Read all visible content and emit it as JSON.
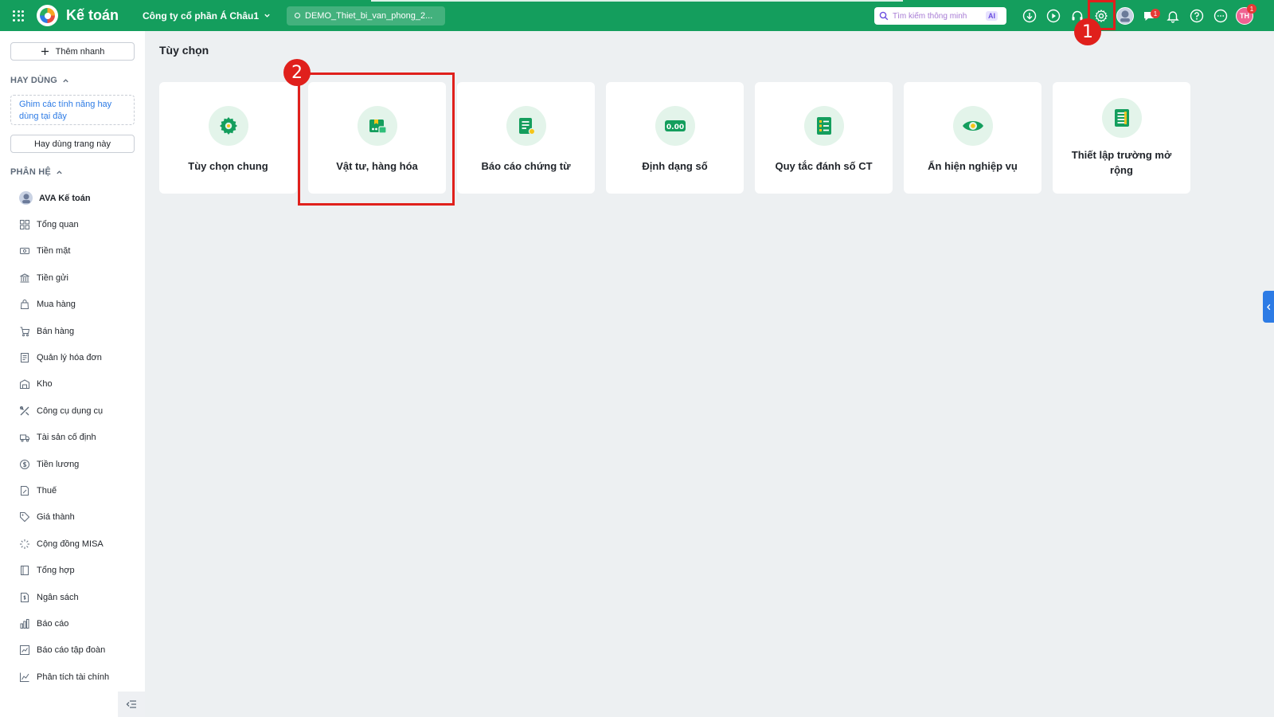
{
  "header": {
    "app_title": "Kế toán",
    "company": "Công ty cổ phần Á Châu1",
    "database": "DEMO_Thiet_bi_van_phong_2...",
    "search_placeholder": "Tìm kiếm thông minh",
    "ai_label": "AI",
    "chat_badge": "1",
    "user_initials": "TH",
    "user_badge": "1"
  },
  "sidebar": {
    "quick_add": "Thêm nhanh",
    "frequent_heading": "HAY DÙNG",
    "pin_hint": "Ghim các tính năng hay dùng tại đây",
    "use_page": "Hay dùng trang này",
    "modules_heading": "PHÂN HỆ",
    "items": [
      {
        "label": "AVA Kế toán",
        "icon": "ava-icon"
      },
      {
        "label": "Tổng quan",
        "icon": "dashboard-icon"
      },
      {
        "label": "Tiền mặt",
        "icon": "cash-icon"
      },
      {
        "label": "Tiền gửi",
        "icon": "bank-icon"
      },
      {
        "label": "Mua hàng",
        "icon": "bag-icon"
      },
      {
        "label": "Bán hàng",
        "icon": "cart-icon"
      },
      {
        "label": "Quản lý hóa đơn",
        "icon": "invoice-icon"
      },
      {
        "label": "Kho",
        "icon": "warehouse-icon"
      },
      {
        "label": "Công cụ dụng cụ",
        "icon": "tools-icon"
      },
      {
        "label": "Tài sản cố định",
        "icon": "truck-icon"
      },
      {
        "label": "Tiền lương",
        "icon": "salary-icon"
      },
      {
        "label": "Thuế",
        "icon": "tax-icon"
      },
      {
        "label": "Giá thành",
        "icon": "tag-icon"
      },
      {
        "label": "Cộng đồng MISA",
        "icon": "community-icon"
      },
      {
        "label": "Tổng hợp",
        "icon": "summary-icon"
      },
      {
        "label": "Ngân sách",
        "icon": "budget-icon"
      },
      {
        "label": "Báo cáo",
        "icon": "report-icon"
      },
      {
        "label": "Báo cáo tập đoàn",
        "icon": "group-report-icon"
      },
      {
        "label": "Phân tích tài chính",
        "icon": "analysis-icon"
      }
    ]
  },
  "main": {
    "title": "Tùy chọn",
    "cards": [
      {
        "label": "Tùy chọn chung",
        "icon": "gear-icon"
      },
      {
        "label": "Vật tư, hàng hóa",
        "icon": "goods-icon"
      },
      {
        "label": "Báo cáo chứng từ",
        "icon": "document-report-icon"
      },
      {
        "label": "Định dạng số",
        "icon": "number-format-icon"
      },
      {
        "label": "Quy tắc đánh số CT",
        "icon": "numbering-rule-icon"
      },
      {
        "label": "Ẩn hiện nghiệp vụ",
        "icon": "eye-icon"
      },
      {
        "label": "Thiết lập trường mở rộng",
        "icon": "extended-field-icon"
      }
    ]
  },
  "annotations": {
    "step1": "1",
    "step2": "2"
  },
  "colors": {
    "brand": "#149e5d",
    "highlight": "#e0201c",
    "accent": "#2d7be5"
  }
}
